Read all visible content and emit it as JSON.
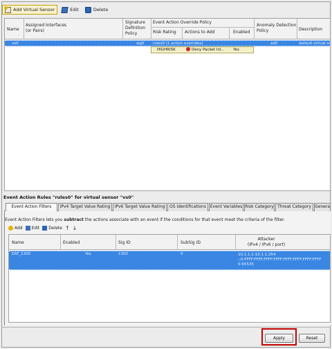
{
  "toolbar": {
    "add_label": "Add Virtual Sensor",
    "edit_label": "Edit",
    "delete_label": "Delete"
  },
  "sensor_table": {
    "headers": {
      "name": "Name",
      "assigned_interfaces": "Assigned Interfaces\n(or Pairs)",
      "signature_policy": "Signature\nDefinition\nPolicy",
      "override_group": "Event Action Override Policy",
      "risk_rating": "Risk Rating",
      "actions_to_add": "Actions to Add",
      "enabled": "Enabled",
      "anomaly": "Anomaly Detection\nPolicy",
      "description": "Description"
    },
    "row": {
      "name": "vs0",
      "assigned_interfaces": "",
      "signature_policy": "sig0",
      "override_policy": "rules0 (1 action overrides)",
      "anomaly": "ad0",
      "description": "default virtual se..."
    },
    "override_row": {
      "risk_rating": "HIGHRISK",
      "action": "Deny Packet Inl...",
      "enabled": "Yes"
    }
  },
  "section_title": "Event Action Rules \"rules0\" for virtual sensor \"vs0\"",
  "tabs": [
    "Event Action Filters",
    "IPv4 Target Value Rating",
    "IPv6 Target Value Rating",
    "OS Identifications",
    "Event Variables",
    "Risk Category",
    "Threat Category",
    "General"
  ],
  "filters_desc": {
    "pre": "Event Action Filters lets you ",
    "bold": "subtract",
    "post": " the actions associate with an event if the conditions for that event meet the criteria of the filter."
  },
  "filters_toolbar": {
    "add": "Add",
    "edit": "Edit",
    "delete": "Delete",
    "up": "↑",
    "down": "↓"
  },
  "filters_table": {
    "headers": {
      "name": "Name",
      "enabled": "Enabled",
      "sig_id": "Sig ID",
      "subsig_id": "SubSig ID",
      "attacker": "Attacker\n(IPv4 / IPv6 / port)"
    },
    "row": {
      "name": "EAF_1300",
      "enabled": "Yes",
      "sig_id": "1300",
      "subsig_id": "0",
      "attacker": "10.1.1.1-10.1.1.254\n::0-FFFF:FFFF:FFFF:FFFF:FFFF:FFFF:FFFF:FFFF\n0-65535"
    }
  },
  "footer": {
    "apply": "Apply",
    "reset": "Reset"
  }
}
